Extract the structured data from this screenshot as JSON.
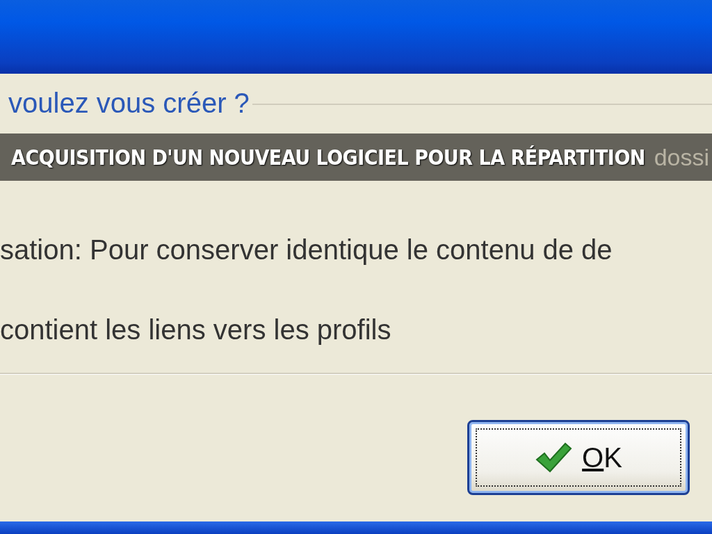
{
  "heading": "voulez vous créer ?",
  "banner": "ACQUISITION D'UN NOUVEAU LOGICIEL POUR LA RÉPARTITION",
  "covered_line_tail": "dossi",
  "options": [
    "sation: Pour conserver identique le contenu de de",
    "contient les liens vers les profils"
  ],
  "button": {
    "label": "OK",
    "mnemonic": true,
    "focused": true
  }
}
